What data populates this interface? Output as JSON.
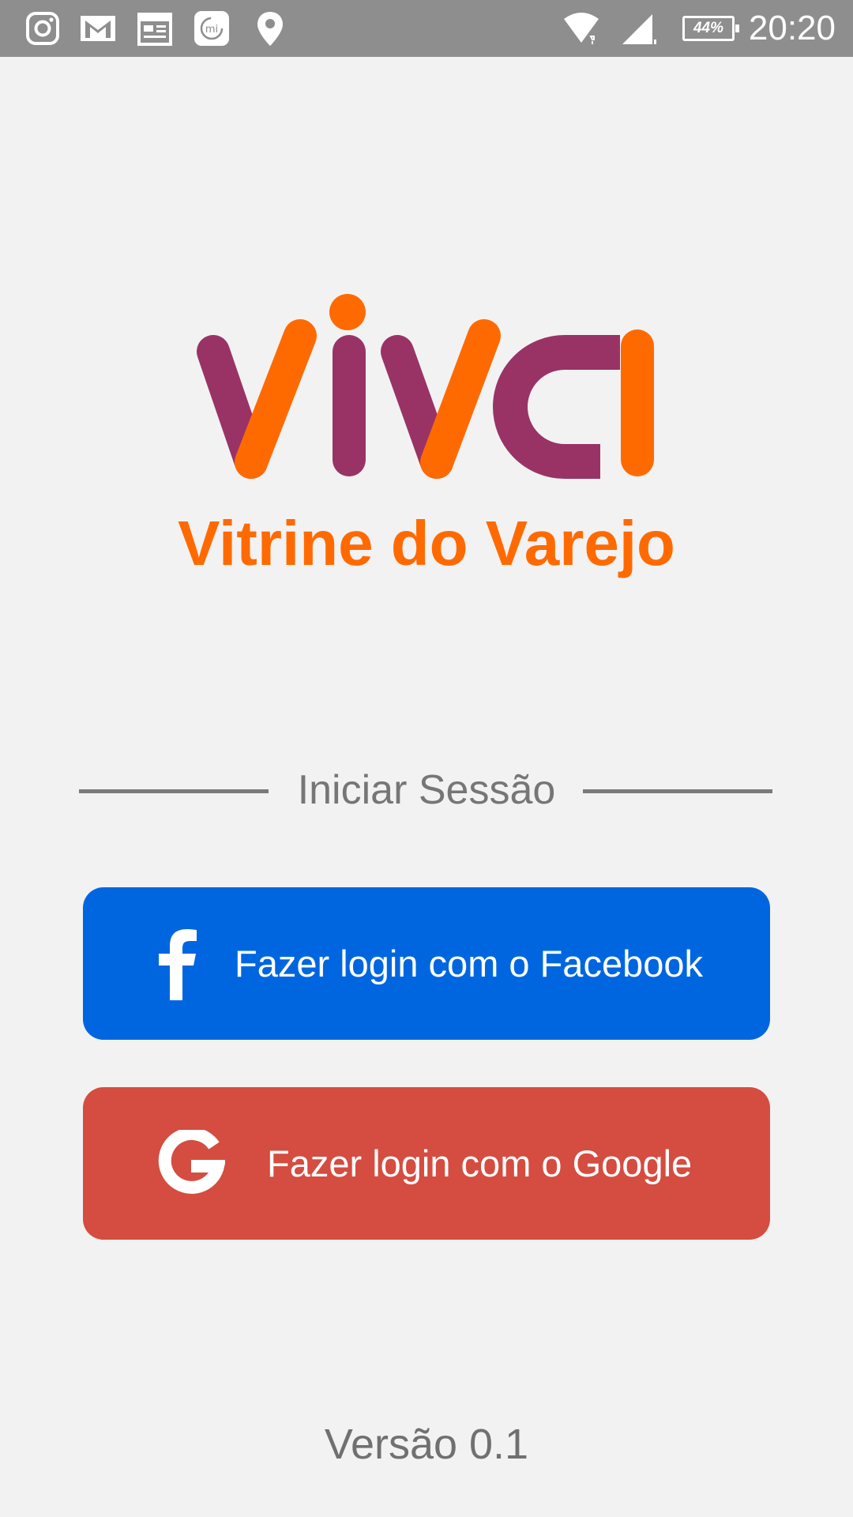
{
  "status_bar": {
    "time": "20:20",
    "battery": "44%",
    "icons": [
      "instagram-icon",
      "gmail-icon",
      "calendar-icon",
      "mi-icon",
      "location-icon",
      "wifi-icon",
      "signal-icon",
      "battery-icon"
    ]
  },
  "brand": {
    "logo_text": "viva",
    "tagline": "Vitrine do Varejo",
    "colors": {
      "primary": "#993366",
      "accent": "#ff6a00"
    }
  },
  "login": {
    "section_title": "Iniciar Sessão",
    "facebook_label": "Fazer login com o Facebook",
    "google_label": "Fazer login com o Google",
    "facebook_color": "#0066e0",
    "google_color": "#d44d40"
  },
  "footer": {
    "version": "Versão 0.1"
  }
}
